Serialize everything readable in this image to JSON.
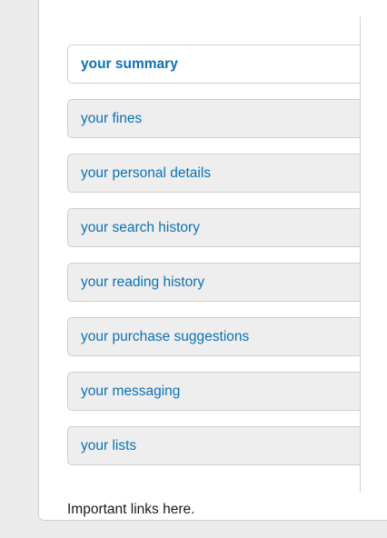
{
  "nav": {
    "items": [
      {
        "label": "your summary",
        "active": true
      },
      {
        "label": "your fines"
      },
      {
        "label": "your personal details"
      },
      {
        "label": "your search history"
      },
      {
        "label": "your reading history"
      },
      {
        "label": "your purchase suggestions"
      },
      {
        "label": "your messaging"
      },
      {
        "label": "your lists"
      }
    ]
  },
  "footer": {
    "text": "Important links here."
  },
  "colors": {
    "link": "#0e71b3",
    "tab_background": "#eeeeee",
    "active_tab_background": "#ffffff",
    "page_background": "#ebebeb"
  }
}
